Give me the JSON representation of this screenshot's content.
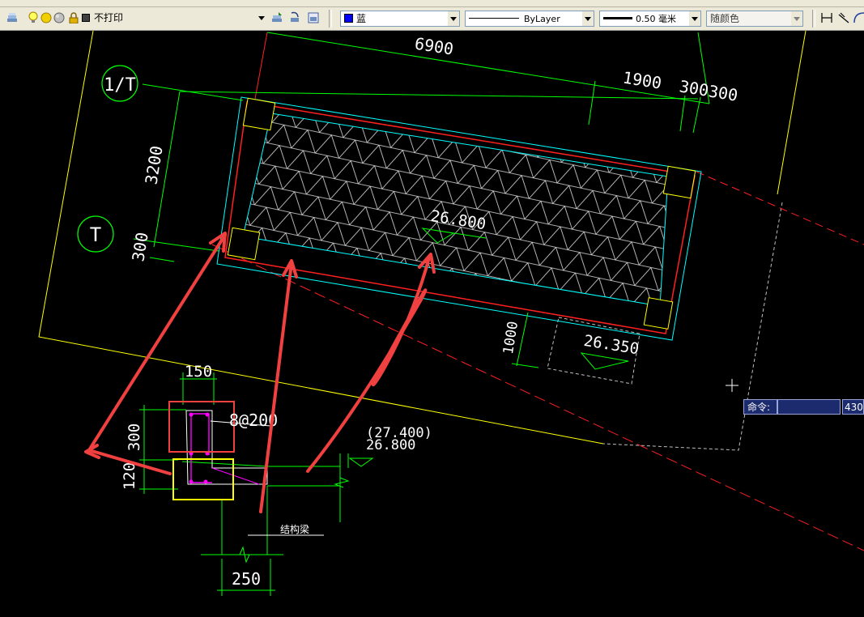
{
  "toolbar": {
    "layer_name": "不打印",
    "color_value": "蓝",
    "color_hex": "#0000ff",
    "linetype_value": "ByLayer",
    "lineweight_value": "0.50 毫米",
    "plotstyle_value": "随颜色"
  },
  "drawing": {
    "dims": {
      "d6900": "6900",
      "d1900": "1900",
      "d300a": "300",
      "d300b": "300",
      "d3200": "3200",
      "d300c": "300",
      "d1000": "1000",
      "d150": "150",
      "d300d": "300",
      "d120": "120",
      "d250": "250"
    },
    "axis_1t": "1/T",
    "axis_t": "T",
    "elev_26800": "26.800",
    "elev_26350": "26.350",
    "elev_27400": "(27.400)",
    "elev_26800b": "26.800",
    "rebar_label": "8@200",
    "beam_label": "结构梁"
  },
  "command": {
    "label": "命令:",
    "counter": "430"
  },
  "colors": {
    "cad_bg": "#000000",
    "dim_green": "#00ff00",
    "outline_yellow": "#ffff00",
    "slab_cyan": "#00ffff",
    "edge_red": "#ff0000",
    "annot_red": "#f04040",
    "rebar_magenta": "#ff00ff"
  }
}
